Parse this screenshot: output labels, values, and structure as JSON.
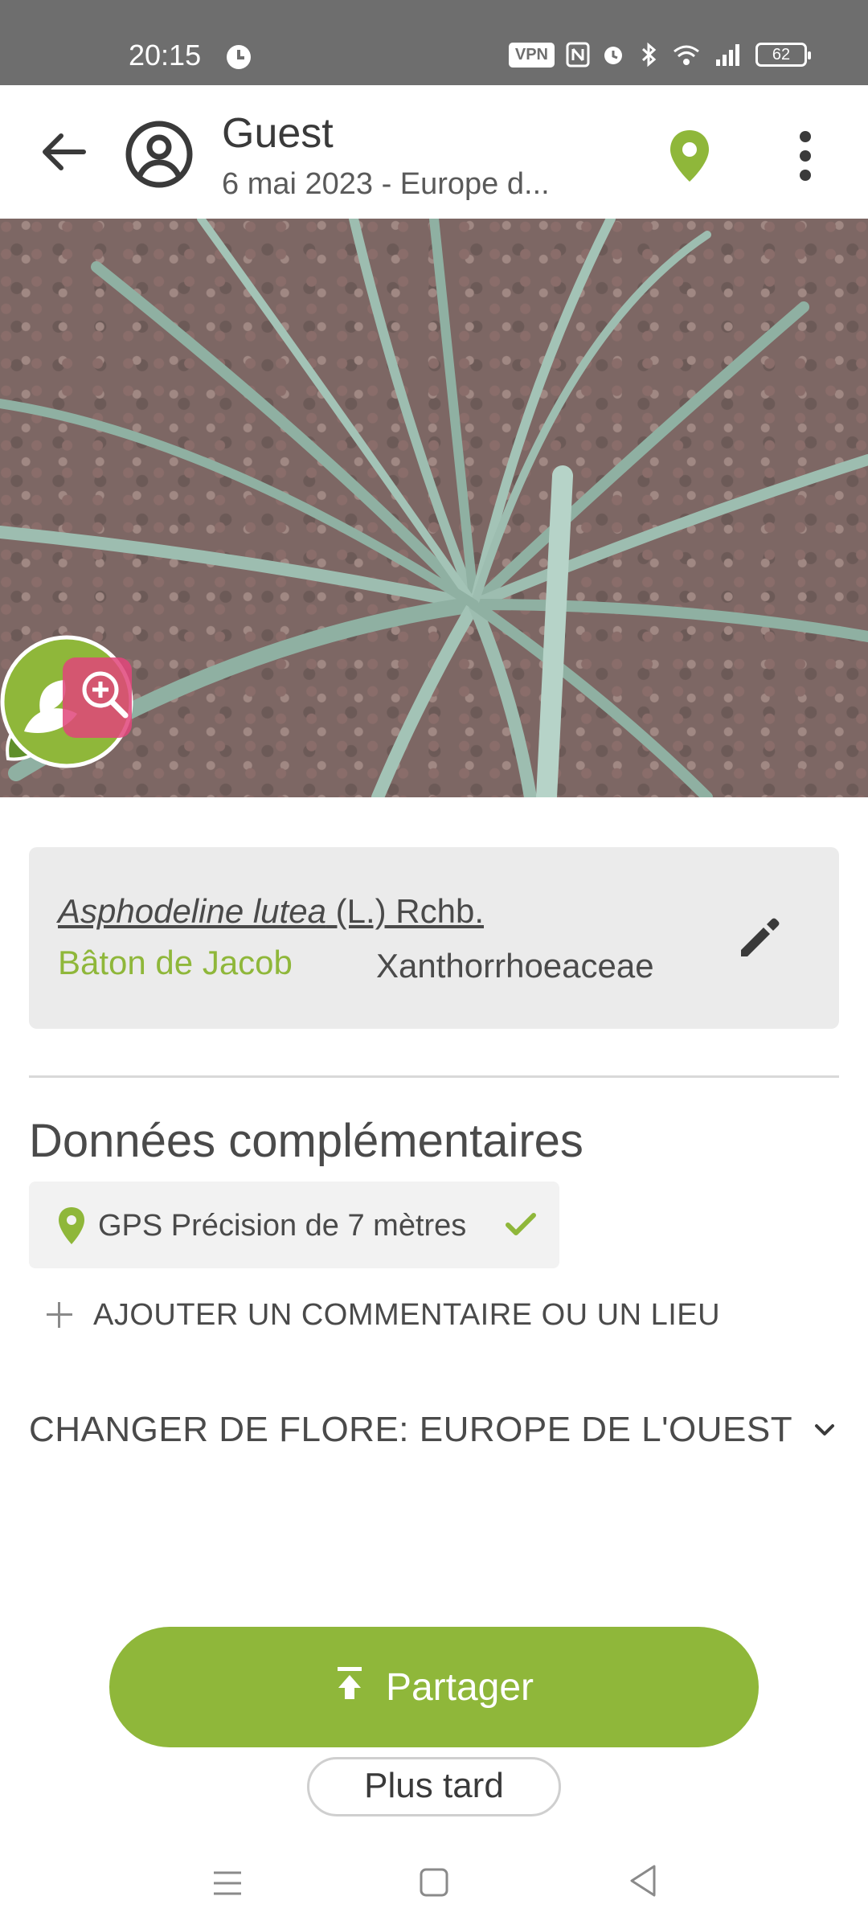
{
  "status_bar": {
    "time": "20:15",
    "vpn": "VPN",
    "battery": "62",
    "icons": [
      "alarm-clock-icon",
      "nfc-icon",
      "alarm-icon",
      "bluetooth-icon",
      "wifi-icon",
      "signal-icon",
      "battery-icon"
    ]
  },
  "header": {
    "title": "Guest",
    "subtitle": "6 mai 2023 - Europe d...",
    "icons": [
      "back-arrow-icon",
      "account-circle-icon",
      "location-pin-icon",
      "more-vert-icon"
    ]
  },
  "photo": {
    "badges": [
      "leaf-logo-icon",
      "zoom-identify-icon"
    ]
  },
  "species": {
    "scientific_genus_species": "Asphodeline lutea",
    "scientific_author": " (L.) Rchb.",
    "common_name": "Bâton de Jacob",
    "family": "Xanthorrhoeaceae"
  },
  "details": {
    "section_title": "Données complémentaires",
    "gps_text": "GPS Précision de 7 mètres",
    "add_comment_label": "AJOUTER UN COMMENTAIRE OU UN LIEU",
    "flora_label": "CHANGER DE FLORE: EUROPE DE L'OUEST"
  },
  "actions": {
    "share_label": "Partager",
    "later_label": "Plus tard"
  },
  "colors": {
    "accent": "#8fb73a",
    "status_bar": "#6e6e6e",
    "card_bg": "#ebebeb"
  }
}
